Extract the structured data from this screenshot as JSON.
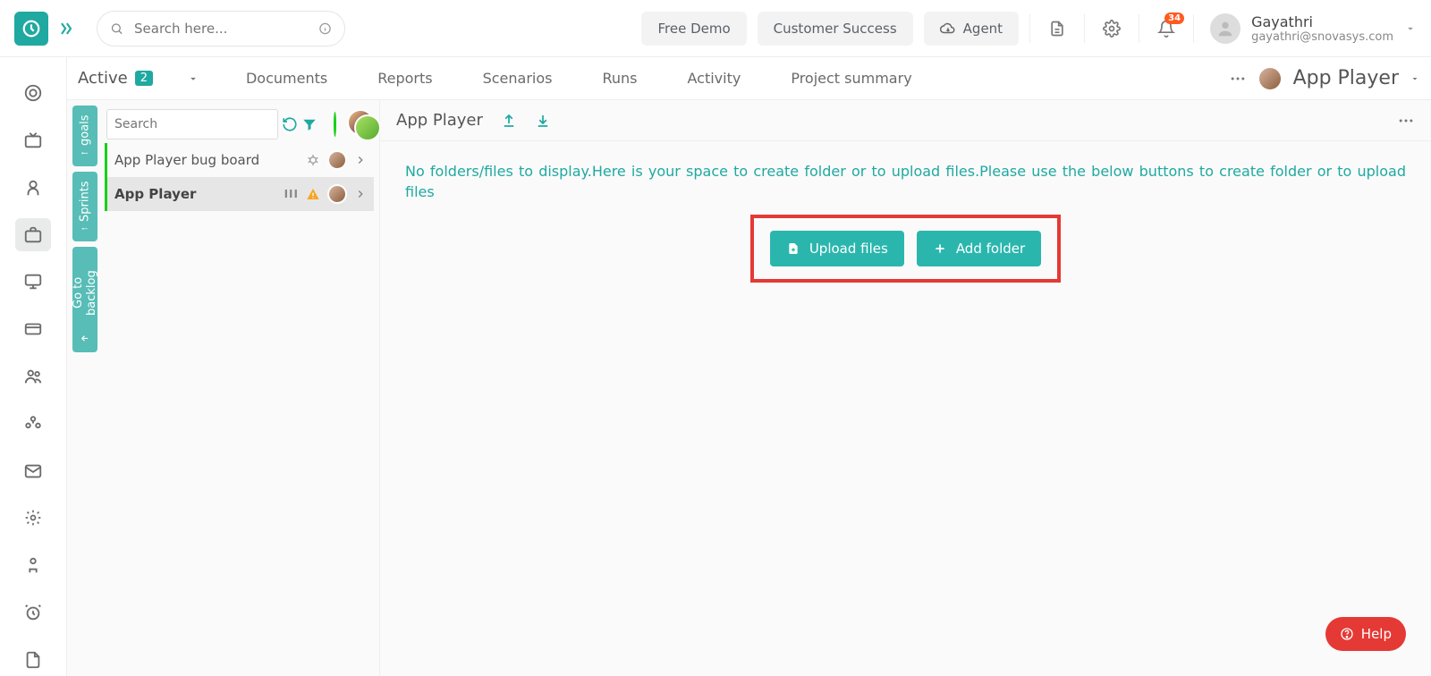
{
  "search_placeholder": "Search here...",
  "top_buttons": {
    "demo": "Free Demo",
    "success": "Customer Success",
    "agent": "Agent"
  },
  "notif_count": "34",
  "user": {
    "name": "Gayathri",
    "email": "gayathri@snovasys.com"
  },
  "sub": {
    "active": "Active",
    "count": "2"
  },
  "tabs": {
    "docs": "Documents",
    "reports": "Reports",
    "scen": "Scenarios",
    "runs": "Runs",
    "activity": "Activity",
    "summary": "Project summary"
  },
  "app_title": "App Player",
  "vtabs": {
    "goals": "goals",
    "sprints": "Sprints",
    "backlog": "Go to backlog"
  },
  "panel_search_placeholder": "Search",
  "items": {
    "bug": "App Player bug board",
    "player": "App Player",
    "cols": "III"
  },
  "main_title": "App Player",
  "empty": "No folders/files to display.Here is your space to create folder or to upload files.Please use the below buttons to create folder or to upload files",
  "btn_upload": "Upload files",
  "btn_folder": "Add folder",
  "help": "Help"
}
